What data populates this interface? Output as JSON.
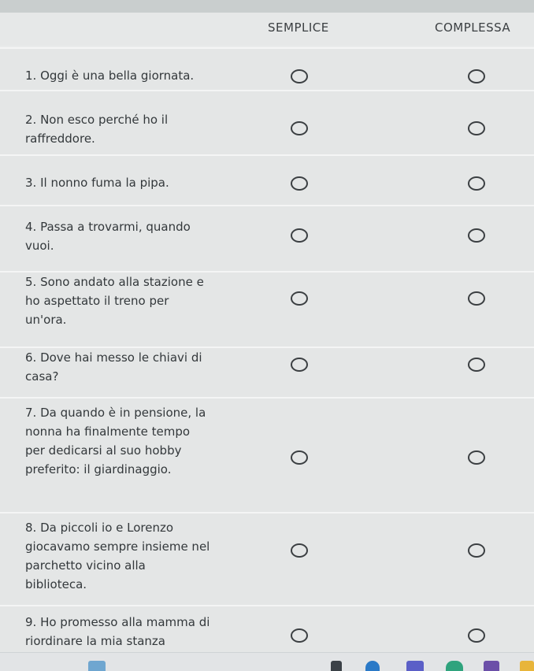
{
  "columns": {
    "semplice": "SEMPLICE",
    "complessa": "COMPLESSA"
  },
  "questions": [
    {
      "text": "1. Oggi è una bella giornata."
    },
    {
      "text": "2. Non esco perché ho il raffreddore."
    },
    {
      "text": "3. Il nonno fuma la pipa."
    },
    {
      "text": "4. Passa a trovarmi, quando vuoi."
    },
    {
      "text": "5. Sono andato alla stazione e ho aspettato il treno per un'ora."
    },
    {
      "text": "6. Dove hai messo le chiavi di casa?"
    },
    {
      "text": "7. Da quando è in pensione, la nonna ha finalmente tempo per dedicarsi al suo hobby preferito: il giardinaggio."
    },
    {
      "text": "8. Da piccoli io e Lorenzo giocavamo sempre insieme nel parchetto vicino alla biblioteca."
    },
    {
      "text": "9. Ho promesso alla mamma di riordinare la mia stanza"
    }
  ],
  "colors": {
    "background": "#e9ebeb",
    "text": "#33383b",
    "radio_border": "#3b3f42"
  },
  "taskbar_icons": [
    "app-icon-blue",
    "app-icon-dark",
    "edge-icon",
    "teams-icon",
    "app-icon-green",
    "app-icon-yellow"
  ]
}
